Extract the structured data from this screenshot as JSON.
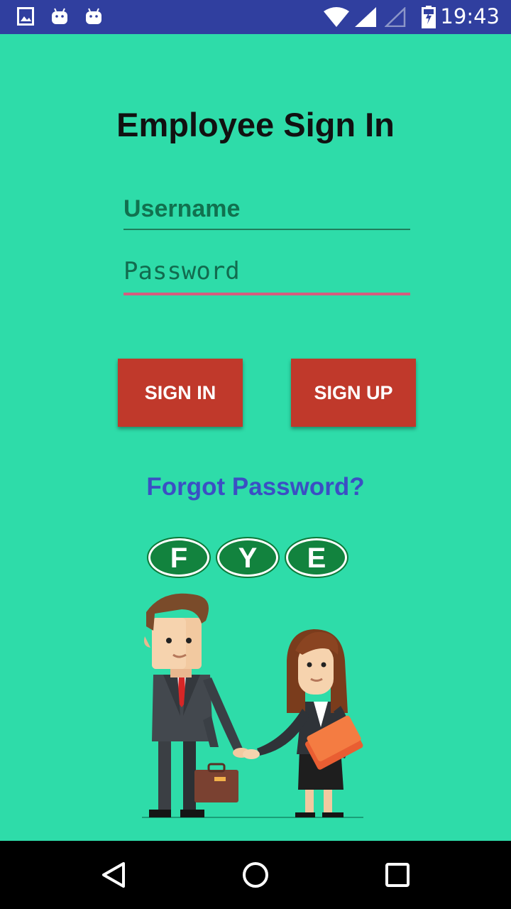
{
  "status_bar": {
    "time": "19:43",
    "icons": [
      "image-notification-icon",
      "android-notification-icon",
      "android-notification-icon",
      "wifi-icon",
      "cell-signal-icon",
      "cell-signal-empty-icon",
      "battery-charging-icon"
    ]
  },
  "login": {
    "title": "Employee Sign In",
    "username_placeholder": "Username",
    "password_placeholder": "Password",
    "sign_in_label": "SIGN IN",
    "sign_up_label": "SIGN UP",
    "forgot_password": "Forgot Password?"
  },
  "logo": {
    "letters": [
      "F",
      "Y",
      "E"
    ]
  },
  "colors": {
    "background": "#2edca9",
    "status_bar": "#303f9f",
    "button": "#c0392b",
    "link": "#3b4fc4",
    "password_underline": "#d65d7e"
  },
  "nav_bar": {
    "icons": [
      "back-icon",
      "home-icon",
      "recents-icon"
    ]
  }
}
